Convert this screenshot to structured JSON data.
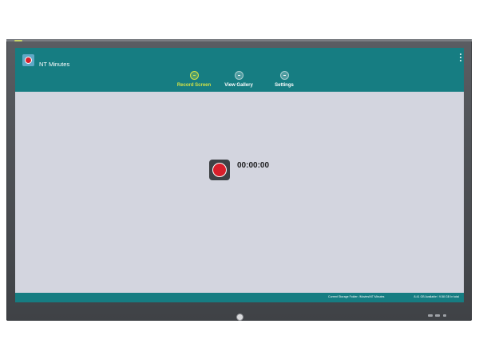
{
  "app": {
    "title": "NT Minutes",
    "icon": "record-app-icon"
  },
  "header": {
    "tabs": [
      {
        "label": "Record Screen",
        "icon": "video-icon",
        "active": true
      },
      {
        "label": "View Gallery",
        "icon": "gallery-icon",
        "active": false
      },
      {
        "label": "Settings",
        "icon": "settings-icon",
        "active": false
      }
    ],
    "menu_icon": "overflow-menu-icon"
  },
  "main": {
    "timer": "00:00:00",
    "record_icon": "record-icon"
  },
  "footer": {
    "storage_folder": "Current Storage Folder: /Movies/NT Minutes",
    "storage_space": "8.41 GB Available / 9.58 GB In total"
  },
  "colors": {
    "header_bg": "#167d82",
    "screen_bg": "#d3d5df",
    "active_tab": "#d4e246",
    "record_red": "#d81f2b",
    "bezel": "#4a4d52"
  }
}
